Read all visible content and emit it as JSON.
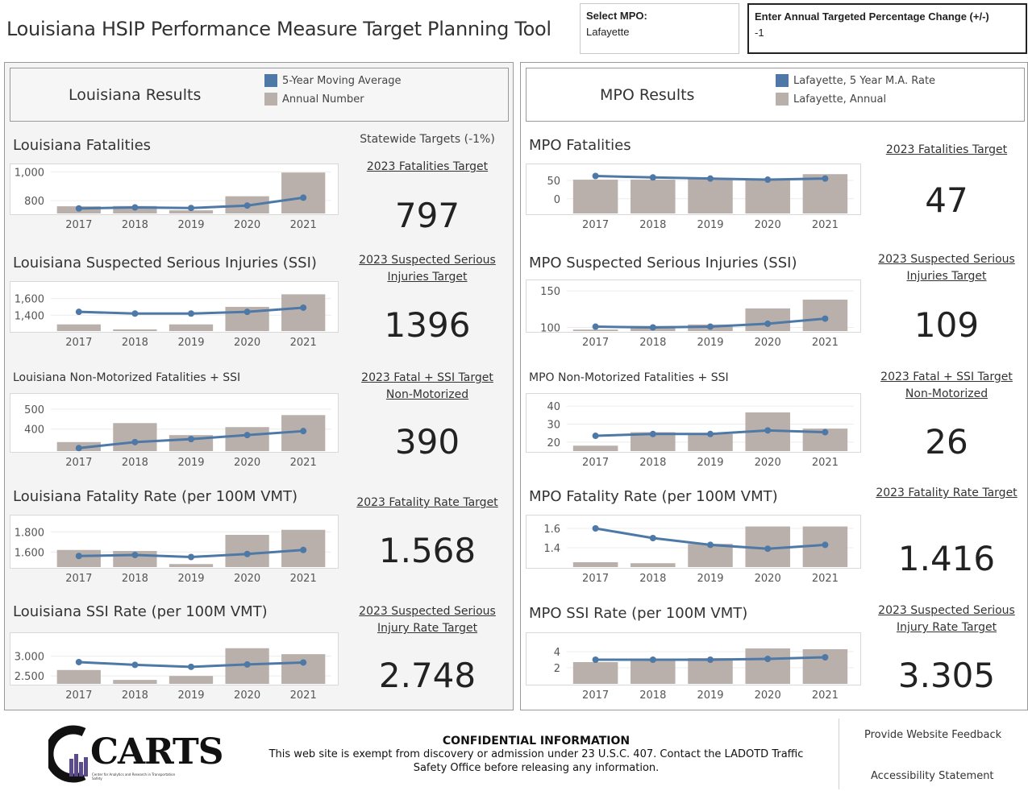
{
  "title": "Louisiana HSIP Performance Measure Target Planning Tool",
  "controls": {
    "mpo_label": "Select MPO:",
    "mpo_value": "Lafayette",
    "pct_label": "Enter Annual Targeted Percentage Change (+/-)",
    "pct_value": "-1"
  },
  "colors": {
    "bar": "#bab0ab",
    "line": "#4e79a7"
  },
  "left": {
    "header": "Louisiana Results",
    "legend": [
      "5-Year Moving Average",
      "Annual Number"
    ],
    "targets_heading": "Statewide Targets (-1%)",
    "sections": [
      {
        "title": "Louisiana Fatalities",
        "target_label": "2023 Fatalities Target",
        "target_value": "797"
      },
      {
        "title": "Louisiana Suspected Serious Injuries (SSI)",
        "target_label": "2023 Suspected Serious Injuries Target",
        "target_value": "1396"
      },
      {
        "title": "Louisiana Non-Motorized Fatalities + SSI",
        "target_label": "2023 Fatal + SSI Target Non-Motorized",
        "target_value": "390"
      },
      {
        "title": "Louisiana Fatality Rate (per 100M VMT)",
        "target_label": "2023 Fatality Rate Target",
        "target_value": "1.568"
      },
      {
        "title": "Louisiana SSI Rate (per 100M VMT)",
        "target_label": "2023 Suspected Serious Injury Rate Target",
        "target_value": "2.748"
      }
    ]
  },
  "right": {
    "header": "MPO Results",
    "legend": [
      "Lafayette, 5 Year M.A. Rate",
      "Lafayette, Annual"
    ],
    "sections": [
      {
        "title": "MPO Fatalities",
        "target_label": "2023 Fatalities Target",
        "target_value": "47"
      },
      {
        "title": "MPO Suspected Serious Injuries (SSI)",
        "target_label": "2023 Suspected Serious Injuries Target",
        "target_value": "109"
      },
      {
        "title": "MPO Non-Motorized Fatalities + SSI",
        "target_label": "2023 Fatal + SSI Target Non-Motorized",
        "target_value": "26"
      },
      {
        "title": "MPO Fatality Rate (per 100M VMT)",
        "target_label": "2023 Fatality Rate Target",
        "target_value": "1.416"
      },
      {
        "title": "MPO SSI Rate (per 100M VMT)",
        "target_label": "2023 Suspected Serious Injury Rate Target",
        "target_value": "3.305"
      }
    ]
  },
  "chart_data": [
    {
      "type": "bar",
      "categories": [
        "2017",
        "2018",
        "2019",
        "2020",
        "2021"
      ],
      "ylim": [
        710,
        1030
      ],
      "yticks": [
        800,
        1000
      ],
      "ytick_labels": [
        "800",
        "1,000"
      ],
      "series": [
        {
          "name": "Annual Number",
          "values": [
            760,
            762,
            732,
            830,
            995
          ]
        },
        {
          "name": "5-Year Moving Average",
          "values": [
            745,
            752,
            748,
            765,
            820
          ]
        }
      ]
    },
    {
      "type": "bar",
      "categories": [
        "2017",
        "2018",
        "2019",
        "2020",
        "2021"
      ],
      "ylim": [
        1210,
        1760
      ],
      "yticks": [
        1400,
        1600
      ],
      "ytick_labels": [
        "1,400",
        "1,600"
      ],
      "series": [
        {
          "name": "Annual Number",
          "values": [
            1290,
            1230,
            1290,
            1500,
            1650
          ]
        },
        {
          "name": "5-Year Moving Average",
          "values": [
            1440,
            1420,
            1420,
            1440,
            1490
          ]
        }
      ]
    },
    {
      "type": "bar",
      "categories": [
        "2017",
        "2018",
        "2019",
        "2020",
        "2021"
      ],
      "ylim": [
        290,
        560
      ],
      "yticks": [
        400,
        500
      ],
      "ytick_labels": [
        "400",
        "500"
      ],
      "series": [
        {
          "name": "Annual Number",
          "values": [
            335,
            430,
            370,
            410,
            470
          ]
        },
        {
          "name": "5-Year Moving Average",
          "values": [
            305,
            335,
            350,
            370,
            390
          ]
        }
      ]
    },
    {
      "type": "bar",
      "categories": [
        "2017",
        "2018",
        "2019",
        "2020",
        "2021"
      ],
      "ylim": [
        1.45,
        1.93
      ],
      "yticks": [
        1.6,
        1.8
      ],
      "ytick_labels": [
        "1.600",
        "1.800"
      ],
      "series": [
        {
          "name": "Annual Number",
          "values": [
            1.62,
            1.61,
            1.48,
            1.77,
            1.82
          ]
        },
        {
          "name": "5-Year Moving Average",
          "values": [
            1.56,
            1.57,
            1.55,
            1.58,
            1.62
          ]
        }
      ]
    },
    {
      "type": "bar",
      "categories": [
        "2017",
        "2018",
        "2019",
        "2020",
        "2021"
      ],
      "ylim": [
        2.3,
        3.5
      ],
      "yticks": [
        2.5,
        3.0
      ],
      "ytick_labels": [
        "2.500",
        "3.000"
      ],
      "series": [
        {
          "name": "Annual Number",
          "values": [
            2.65,
            2.4,
            2.5,
            3.2,
            3.05
          ]
        },
        {
          "name": "5-Year Moving Average",
          "values": [
            2.85,
            2.78,
            2.73,
            2.79,
            2.84
          ]
        }
      ]
    },
    {
      "type": "bar",
      "categories": [
        "2017",
        "2018",
        "2019",
        "2020",
        "2021"
      ],
      "ylim": [
        -40,
        85
      ],
      "yticks": [
        0,
        50
      ],
      "ytick_labels": [
        "0",
        "50"
      ],
      "series": [
        {
          "name": "Lafayette, Annual",
          "values": [
            52,
            52,
            55,
            52,
            67
          ]
        },
        {
          "name": "Lafayette, 5 Year M.A. Rate",
          "values": [
            62,
            58,
            55,
            52,
            55
          ]
        }
      ]
    },
    {
      "type": "bar",
      "categories": [
        "2017",
        "2018",
        "2019",
        "2020",
        "2021"
      ],
      "ylim": [
        95,
        160
      ],
      "yticks": [
        100,
        150
      ],
      "ytick_labels": [
        "100",
        "150"
      ],
      "series": [
        {
          "name": "Lafayette, Annual",
          "values": [
            97,
            102,
            104,
            126,
            138
          ]
        },
        {
          "name": "Lafayette, 5 Year M.A. Rate",
          "values": [
            101,
            100,
            101,
            105,
            112
          ]
        }
      ]
    },
    {
      "type": "bar",
      "categories": [
        "2017",
        "2018",
        "2019",
        "2020",
        "2021"
      ],
      "ylim": [
        15,
        45
      ],
      "yticks": [
        20,
        30,
        40
      ],
      "ytick_labels": [
        "20",
        "30",
        "40"
      ],
      "series": [
        {
          "name": "Lafayette, Annual",
          "values": [
            18,
            25.5,
            24.5,
            36.5,
            27.5
          ]
        },
        {
          "name": "Lafayette, 5 Year M.A. Rate",
          "values": [
            23.5,
            24.5,
            24.5,
            26.5,
            25.5
          ]
        }
      ]
    },
    {
      "type": "bar",
      "categories": [
        "2017",
        "2018",
        "2019",
        "2020",
        "2021"
      ],
      "ylim": [
        1.2,
        1.7
      ],
      "yticks": [
        1.4,
        1.6
      ],
      "ytick_labels": [
        "1.4",
        "1.6"
      ],
      "series": [
        {
          "name": "Lafayette, Annual",
          "values": [
            1.25,
            1.24,
            1.44,
            1.62,
            1.62
          ]
        },
        {
          "name": "Lafayette, 5 Year M.A. Rate",
          "values": [
            1.6,
            1.5,
            1.43,
            1.39,
            1.43
          ]
        }
      ]
    },
    {
      "type": "bar",
      "categories": [
        "2017",
        "2018",
        "2019",
        "2020",
        "2021"
      ],
      "ylim": [
        0,
        5.9
      ],
      "yticks": [
        2,
        4
      ],
      "ytick_labels": [
        "2",
        "4"
      ],
      "series": [
        {
          "name": "Lafayette, Annual",
          "values": [
            2.7,
            3.0,
            3.2,
            4.4,
            4.3
          ]
        },
        {
          "name": "Lafayette, 5 Year M.A. Rate",
          "values": [
            3.0,
            3.0,
            3.0,
            3.1,
            3.3
          ]
        }
      ]
    }
  ],
  "footer": {
    "logo_text": "CARTS",
    "logo_subtitle": "Center for Analytics and Research in Transportation Safety",
    "confidential_heading": "CONFIDENTIAL INFORMATION",
    "confidential_line1": "This web site is exempt from discovery or admission under 23 U.S.C. 407. Contact the LADOTD Traffic",
    "confidential_line2": "Safety Office before releasing any information.",
    "feedback": "Provide Website Feedback",
    "accessibility": "Accessibility Statement"
  }
}
